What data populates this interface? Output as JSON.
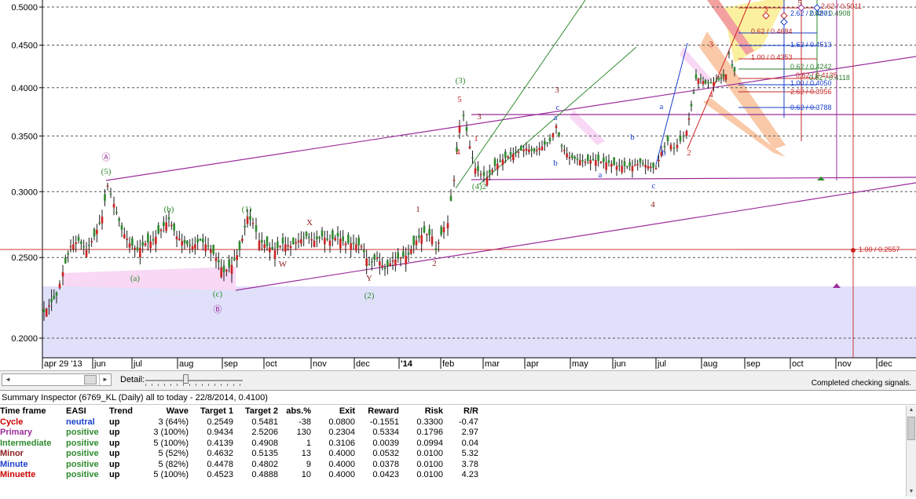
{
  "chart": {
    "price_axis": {
      "ticks": [
        {
          "value": 0.5,
          "label": "0.5000"
        },
        {
          "value": 0.45,
          "label": "0.4500"
        },
        {
          "value": 0.4,
          "label": "0.4000"
        },
        {
          "value": 0.35,
          "label": "0.3500"
        },
        {
          "value": 0.3,
          "label": "0.3000"
        },
        {
          "value": 0.25,
          "label": "0.2500"
        },
        {
          "value": 0.2,
          "label": "0.2000"
        }
      ]
    },
    "time_axis": {
      "labels": [
        "apr 29 '13",
        "jun",
        "jul",
        "aug",
        "sep",
        "oct",
        "nov",
        "dec",
        "'14",
        "feb",
        "mar",
        "apr",
        "may",
        "jun",
        "jul",
        "aug",
        "sep",
        "oct",
        "nov",
        "dec"
      ]
    },
    "wave_labels": [
      {
        "text": "Ⓐ",
        "color": "#9b2d9b"
      },
      {
        "text": "(5)",
        "color": "#2e8b2e"
      },
      {
        "text": "(a)",
        "color": "#2e8b2e"
      },
      {
        "text": "(b)",
        "color": "#2e8b2e"
      },
      {
        "text": "(c)",
        "color": "#2e8b2e"
      },
      {
        "text": "Ⓑ",
        "color": "#9b2d9b"
      },
      {
        "text": "(1)",
        "color": "#2e8b2e"
      },
      {
        "text": "X",
        "color": "#8b1a1a"
      },
      {
        "text": "W",
        "color": "#8b1a1a"
      },
      {
        "text": "Y",
        "color": "#8b1a1a"
      },
      {
        "text": "(2)",
        "color": "#2e8b2e"
      },
      {
        "text": "1",
        "color": "#8b1a1a"
      },
      {
        "text": "2",
        "color": "#8b1a1a"
      },
      {
        "text": "(3)",
        "color": "#2e8b2e"
      },
      {
        "text": "3",
        "color": "#8b1a1a"
      },
      {
        "text": "5",
        "color": "#cc2222"
      },
      {
        "text": "4",
        "color": "#cc2222"
      },
      {
        "text": "1",
        "color": "#cc2222"
      },
      {
        "text": "(4)2",
        "color": "#2e8b2e"
      },
      {
        "text": "3",
        "color": "#8b1a1a"
      },
      {
        "text": "c",
        "color": "#1a3fcc"
      },
      {
        "text": "a",
        "color": "#1a3fcc"
      },
      {
        "text": "b",
        "color": "#1a3fcc"
      },
      {
        "text": "a",
        "color": "#1a3fcc"
      },
      {
        "text": "b",
        "color": "#1a3fcc"
      },
      {
        "text": "c",
        "color": "#1a3fcc"
      },
      {
        "text": "4",
        "color": "#8b1a1a"
      },
      {
        "text": "a",
        "color": "#1a3fcc"
      },
      {
        "text": "b",
        "color": "#1a3fcc"
      },
      {
        "text": "2",
        "color": "#cc2222"
      },
      {
        "text": "3",
        "color": "#cc2222"
      },
      {
        "text": "4",
        "color": "#cc2222"
      },
      {
        "text": "5",
        "color": "#8b1a1a"
      },
      {
        "text": "3",
        "color": "#cc2222"
      }
    ],
    "fib_labels": [
      {
        "text": "2.62 / 0.5011",
        "color": "#c62828"
      },
      {
        "text": "2.62 / 0.4908",
        "color": "#2e7d32"
      },
      {
        "text": "2.62 / 0.4801",
        "color": "#1a3fcc"
      },
      {
        "text": "0.62 / 0.4684",
        "color": "#c62828"
      },
      {
        "text": "1.62 / 0.4513",
        "color": "#1a3fcc"
      },
      {
        "text": "1.00 / 0.4353",
        "color": "#c62828"
      },
      {
        "text": "0.62 / 0.4242",
        "color": "#2e7d32"
      },
      {
        "text": "0.62 / 0.4135",
        "color": "#c62828"
      },
      {
        "text": "0.62 / 0.4118",
        "color": "#2e7d32"
      },
      {
        "text": "1.00 / 0.4050",
        "color": "#1a3fcc"
      },
      {
        "text": "2.62 / 0.3956",
        "color": "#c62828"
      },
      {
        "text": "0.62 / 0.3788",
        "color": "#1a3fcc"
      },
      {
        "text": "1.00 / 0.2557",
        "color": "#c62828"
      }
    ]
  },
  "controls": {
    "scroll_left": "◄",
    "scroll_right": "►",
    "detail_label": "Detail:",
    "status": "Completed checking signals."
  },
  "inspector": {
    "title": "Summary Inspector (6769_KL (Daily)  all to today - 22/8/2014, 0.4100)",
    "columns": [
      "Time frame",
      "EASI",
      "Trend",
      "Wave",
      "Target 1",
      "Target 2",
      "abs.%",
      "Exit",
      "Reward",
      "Risk",
      "R/R"
    ],
    "rows": [
      {
        "timeframe": "Cycle",
        "color": "#cc0000",
        "easi": "neutral",
        "easi_color": "#1a3fcc",
        "trend": "up",
        "wave": "3 (64%)",
        "target1": "0.2549",
        "target2": "0.5481",
        "abs": "-38",
        "exit": "0.0800",
        "reward": "-0.1551",
        "risk": "0.3300",
        "rr": "-0.47"
      },
      {
        "timeframe": "Primary",
        "color": "#9b2d9b",
        "easi": "positive",
        "easi_color": "#2e8b2e",
        "trend": "up",
        "wave": "3 (100%)",
        "target1": "0.9434",
        "target2": "2.5206",
        "abs": "130",
        "exit": "0.2304",
        "reward": "0.5334",
        "risk": "0.1796",
        "rr": "2.97"
      },
      {
        "timeframe": "Intermediate",
        "color": "#2e8b2e",
        "easi": "positive",
        "easi_color": "#2e8b2e",
        "trend": "up",
        "wave": "5 (100%)",
        "target1": "0.4139",
        "target2": "0.4908",
        "abs": "1",
        "exit": "0.3106",
        "reward": "0.0039",
        "risk": "0.0994",
        "rr": "0.04"
      },
      {
        "timeframe": "Minor",
        "color": "#8b1a1a",
        "easi": "positive",
        "easi_color": "#2e8b2e",
        "trend": "up",
        "wave": "5 (52%)",
        "target1": "0.4632",
        "target2": "0.5135",
        "abs": "13",
        "exit": "0.4000",
        "reward": "0.0532",
        "risk": "0.0100",
        "rr": "5.32"
      },
      {
        "timeframe": "Minute",
        "color": "#1a3fcc",
        "easi": "positive",
        "easi_color": "#2e8b2e",
        "trend": "up",
        "wave": "5 (82%)",
        "target1": "0.4478",
        "target2": "0.4802",
        "abs": "9",
        "exit": "0.4000",
        "reward": "0.0378",
        "risk": "0.0100",
        "rr": "3.78"
      },
      {
        "timeframe": "Minuette",
        "color": "#cc0000",
        "easi": "positive",
        "easi_color": "#2e8b2e",
        "trend": "up",
        "wave": "5 (100%)",
        "target1": "0.4523",
        "target2": "0.4888",
        "abs": "10",
        "exit": "0.4000",
        "reward": "0.0423",
        "risk": "0.0100",
        "rr": "4.23"
      }
    ]
  }
}
